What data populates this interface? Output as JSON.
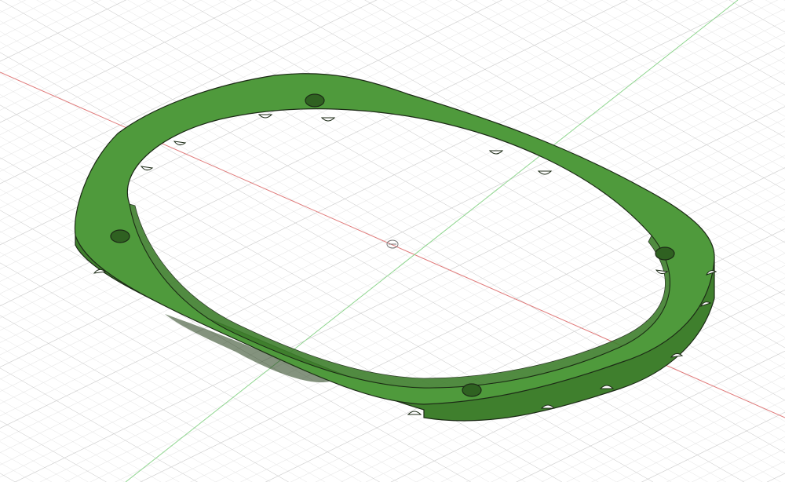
{
  "viewport": {
    "background": "#ffffff",
    "grid_minor_color": "#e3e3e3",
    "grid_major_color": "#c9c9c9",
    "x_axis_color": "#e07a7a",
    "y_axis_color": "#8fd68f"
  },
  "model": {
    "name": "oval-speaker-ring",
    "top_face_color": "#4f9a3c",
    "side_face_color": "#3f7f2d",
    "edge_color": "#1c2a16",
    "mounting_holes": 4,
    "notches": 16
  }
}
